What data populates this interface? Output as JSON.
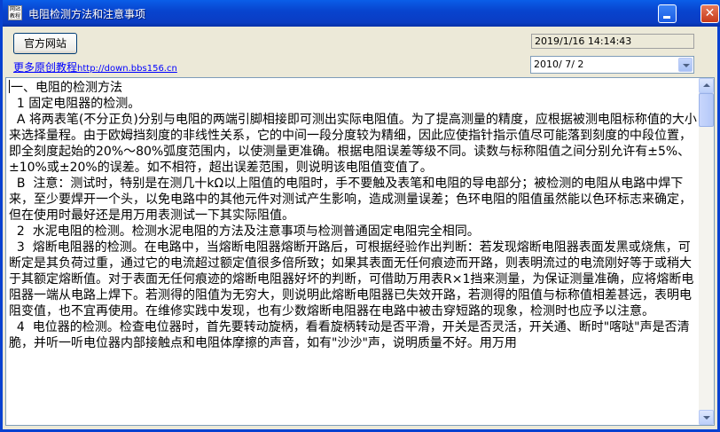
{
  "window": {
    "title": "电阻检测方法和注意事项",
    "icon_text": "网站 教程"
  },
  "toolbar": {
    "official_site_label": "官方网站",
    "tutorial_label": "更多原创教程",
    "tutorial_url": "http://down.bbs156.cn"
  },
  "datetime": {
    "current": "2019/1/16 14:14:43",
    "date_value": "2010/ 7/ 2"
  },
  "article": {
    "paragraphs": [
      "一、电阻的检测方法",
      "  1 固定电阻器的检测。",
      "  A 将两表笔(不分正负)分别与电阻的两端引脚相接即可测出实际电阻值。为了提高测量的精度，应根据被测电阻标称值的大小来选择量程。由于欧姆挡刻度的非线性关系，它的中间一段分度较为精细，因此应使指针指示值尽可能落到刻度的中段位置，即全刻度起始的20%～80%弧度范围内，以使测量更准确。根据电阻误差等级不同。读数与标称阻值之间分别允许有±5%、±10%或±20%的误差。如不相符，超出误差范围，则说明该电阻值变值了。",
      "  B  注意：测试时，特别是在测几十kΩ以上阻值的电阻时，手不要触及表笔和电阻的导电部分；被检测的电阻从电路中焊下来，至少要焊开一个头，以免电路中的其他元件对测试产生影响，造成测量误差；色环电阻的阻值虽然能以色环标志来确定，但在使用时最好还是用万用表测试一下其实际阻值。",
      "  2  水泥电阻的检测。检测水泥电阻的方法及注意事项与检测普通固定电阻完全相同。",
      "  3  熔断电阻器的检测。在电路中，当熔断电阻器熔断开路后，可根据经验作出判断：若发现熔断电阻器表面发黑或烧焦，可断定是其负荷过重，通过它的电流超过额定值很多倍所致；如果其表面无任何痕迹而开路，则表明流过的电流刚好等于或稍大于其额定熔断值。对于表面无任何痕迹的熔断电阻器好坏的判断，可借助万用表R×1挡来测量，为保证测量准确，应将熔断电阻器一端从电路上焊下。若测得的阻值为无穷大，则说明此熔断电阻器已失效开路，若测得的阻值与标称值相差甚远，表明电阻变值，也不宜再使用。在维修实践中发现，也有少数熔断电阻器在电路中被击穿短路的现象，检测时也应予以注意。",
      "  4  电位器的检测。检查电位器时，首先要转动旋柄，看看旋柄转动是否平滑，开关是否灵活，开关通、断时\"喀哒\"声是否清脆，并听一听电位器内部接触点和电阻体摩擦的声音，如有\"沙沙\"声，说明质量不好。用万用"
    ]
  }
}
